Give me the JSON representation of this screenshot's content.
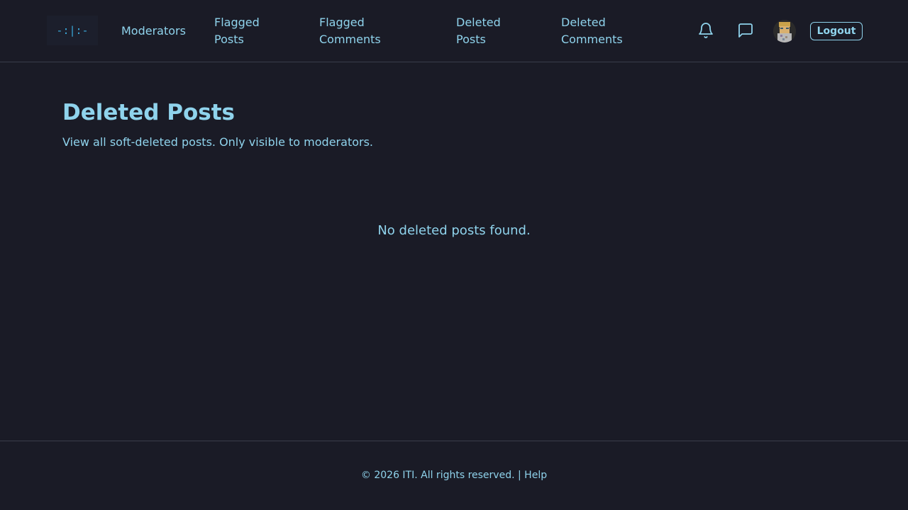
{
  "header": {
    "logo_text": "-:|:-",
    "nav": {
      "moderators": "Moderators",
      "flagged_posts": "Flagged Posts",
      "flagged_comments": "Flagged Comments",
      "deleted_posts": "Deleted Posts",
      "deleted_comments": "Deleted Comments"
    },
    "icons": {
      "notifications": "bell-icon",
      "messages": "chat-icon"
    },
    "logout_label": "Logout"
  },
  "main": {
    "title": "Deleted Posts",
    "subtitle": "View all soft-deleted posts. Only visible to moderators.",
    "empty_message": "No deleted posts found."
  },
  "footer": {
    "copyright": "© 2026 ITI. All rights reserved.",
    "separator": " | ",
    "help_label": "Help"
  },
  "colors": {
    "background": "#1a1b26",
    "accent": "#8fd3ec",
    "border": "#3a3d4a"
  }
}
